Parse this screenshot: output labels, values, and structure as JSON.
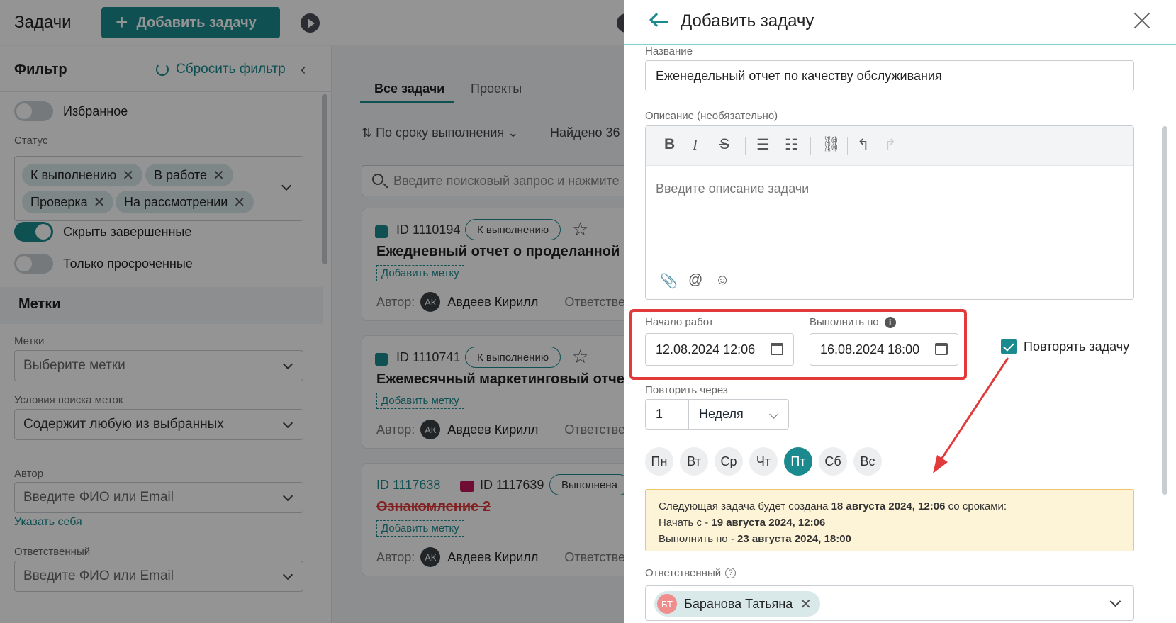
{
  "topbar": {
    "title": "Задачи",
    "add_task_label": "Добавить задачу"
  },
  "sidebar": {
    "filter_title": "Фильтр",
    "reset_filter": "Сбросить фильтр",
    "favorites_label": "Избранное",
    "status_label": "Статус",
    "status_chips": [
      "К выполнению",
      "В работе",
      "Проверка",
      "На рассмотрении"
    ],
    "hide_completed": "Скрыть завершенные",
    "only_overdue": "Только просроченные",
    "tags_section": "Метки",
    "tags_label": "Метки",
    "tags_placeholder": "Выберите метки",
    "tag_conditions_label": "Условия поиска меток",
    "tag_conditions_value": "Содержит любую из выбранных",
    "author_label": "Автор",
    "author_placeholder": "Введите ФИО или Email",
    "specify_self": "Указать себя",
    "responsible_label": "Ответственный",
    "responsible_placeholder": "Введите ФИО или Email"
  },
  "main": {
    "tabs": [
      "Все задачи",
      "Проекты"
    ],
    "sort_label": "По сроку выполнения",
    "found_label": "Найдено 36",
    "search_placeholder": "Введите поисковый запрос и нажмите",
    "cards": [
      {
        "id": "ID 1110194",
        "status": "К выполнению",
        "title": "Ежедневный отчет о проделанной",
        "add_tag": "Добавить метку",
        "author_label": "Автор:",
        "author_initials": "АК",
        "author_name": "Авдеев Кирилл",
        "responsible_label": "Ответстве"
      },
      {
        "id": "ID 1110741",
        "status": "К выполнению",
        "title": "Ежемесячный маркетинговый отче",
        "add_tag": "Добавить метку",
        "author_label": "Автор:",
        "author_initials": "АК",
        "author_name": "Авдеев Кирилл",
        "responsible_label": "Ответстве"
      },
      {
        "id": "ID 1117638",
        "id2": "ID 1117639",
        "status": "Выполнена",
        "title": "Ознакомление 2",
        "add_tag": "Добавить метку",
        "author_label": "Автор:",
        "author_initials": "АК",
        "author_name": "Авдеев Кирилл",
        "responsible_label": "Ответстве"
      }
    ]
  },
  "panel": {
    "title": "Добавить задачу",
    "name_label": "Название",
    "name_value": "Еженедельный отчет по качеству обслуживания",
    "description_label": "Описание (необязательно)",
    "description_placeholder": "Введите описание задачи",
    "start_label": "Начало работ",
    "start_value": "12.08.2024 12:06",
    "due_label": "Выполнить по",
    "due_value": "16.08.2024 18:00",
    "repeat_checkbox": "Повторять задачу",
    "repeat_every_label": "Повторить через",
    "repeat_every_value": "1",
    "repeat_unit": "Неделя",
    "days": [
      "Пн",
      "Вт",
      "Ср",
      "Чт",
      "Пт",
      "Сб",
      "Вс"
    ],
    "selected_day": "Пт",
    "notice": {
      "line1_prefix": "Следующая задача будет создана ",
      "line1_bold": "18 августа 2024, 12:06",
      "line1_suffix": " со сроками:",
      "line2_prefix": "Начать с - ",
      "line2_bold": "19 августа 2024, 12:06",
      "line3_prefix": "Выполнить по - ",
      "line3_bold": "23 августа 2024, 18:00"
    },
    "responsible_label": "Ответственный",
    "responsible_initials": "БТ",
    "responsible_name": "Баранова Татьяна"
  },
  "colors": {
    "accent": "#1a8a8f",
    "highlight_box": "#e03a3a",
    "notice_bg": "#fdf3d7"
  }
}
